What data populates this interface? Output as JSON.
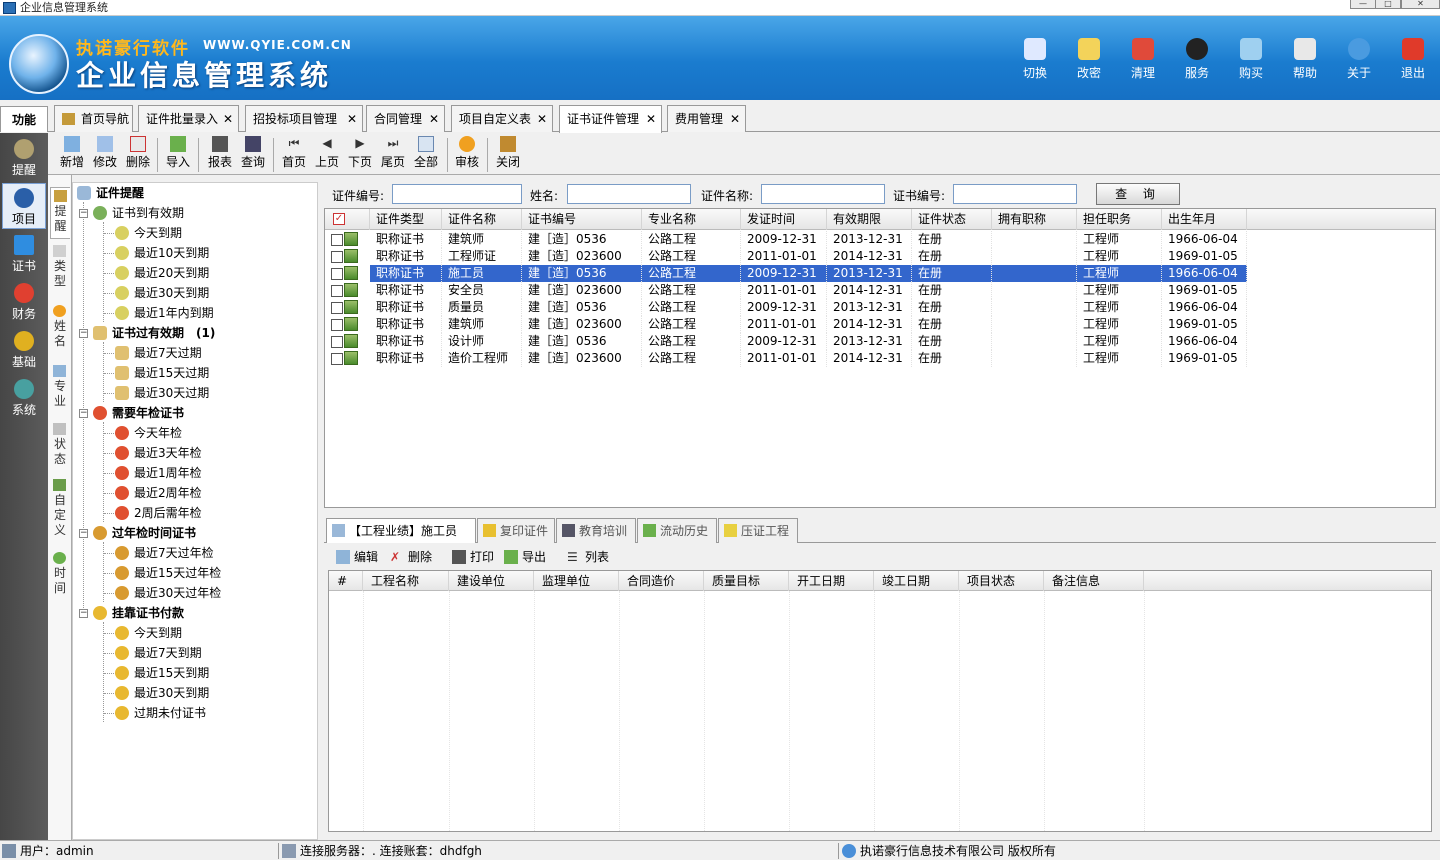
{
  "window": {
    "title": "企业信息管理系统"
  },
  "banner": {
    "brand": "执诺豪行软件",
    "url": "WWW.QYIE.COM.CN",
    "system_name": "企业信息管理系统"
  },
  "top_buttons": [
    "切换",
    "改密",
    "清理",
    "服务",
    "购买",
    "帮助",
    "关于",
    "退出"
  ],
  "func_label": "功能",
  "tabs": [
    "首页导航",
    "证件批量录入",
    "招投标项目管理",
    "合同管理",
    "项目自定义表",
    "证书证件管理",
    "费用管理"
  ],
  "toolbar": [
    "新增",
    "修改",
    "删除",
    "导入",
    "报表",
    "查询",
    "首页",
    "上页",
    "下页",
    "尾页",
    "全部",
    "审核",
    "关闭"
  ],
  "left_nav": [
    "提醒",
    "项目",
    "证书",
    "财务",
    "基础",
    "系统"
  ],
  "vtabs": [
    "提醒",
    "类型",
    "姓名",
    "专业",
    "状态",
    "自定义",
    "时间"
  ],
  "tree": {
    "root": "证件提醒",
    "nodes": [
      {
        "label": "证书到有效期",
        "children": [
          "今天到期",
          "最近10天到期",
          "最近20天到期",
          "最近30天到期",
          "最近1年内到期"
        ]
      },
      {
        "label": "证书过有效期　(1)",
        "bold": true,
        "children": [
          "最近7天过期",
          "最近15天过期",
          "最近30天过期"
        ]
      },
      {
        "label": "需要年检证书",
        "bold": true,
        "children": [
          "今天年检",
          "最近3天年检",
          "最近1周年检",
          "最近2周年检",
          "2周后需年检"
        ]
      },
      {
        "label": "过年检时间证书",
        "bold": true,
        "children": [
          "最近7天过年检",
          "最近15天过年检",
          "最近30天过年检"
        ]
      },
      {
        "label": "挂靠证书付款",
        "bold": true,
        "children": [
          "今天到期",
          "最近7天到期",
          "最近15天到期",
          "最近30天到期",
          "过期未付证书"
        ]
      }
    ]
  },
  "search": {
    "labels": [
      "证件编号:",
      "姓名:",
      "证件名称:",
      "证书编号:"
    ],
    "button": "查 询"
  },
  "grid": {
    "columns": [
      "证件类型",
      "证件名称",
      "证书编号",
      "专业名称",
      "发证时间",
      "有效期限",
      "证件状态",
      "拥有职称",
      "担任职务",
      "出生年月"
    ],
    "rows": [
      [
        "职称证书",
        "建筑师",
        "建［造］0536",
        "公路工程",
        "2009-12-31",
        "2013-12-31",
        "在册",
        "",
        "工程师",
        "1966-06-04"
      ],
      [
        "职称证书",
        "工程师证",
        "建［造］023600",
        "公路工程",
        "2011-01-01",
        "2014-12-31",
        "在册",
        "",
        "工程师",
        "1969-01-05"
      ],
      [
        "职称证书",
        "施工员",
        "建［造］0536",
        "公路工程",
        "2009-12-31",
        "2013-12-31",
        "在册",
        "",
        "工程师",
        "1966-06-04"
      ],
      [
        "职称证书",
        "安全员",
        "建［造］023600",
        "公路工程",
        "2011-01-01",
        "2014-12-31",
        "在册",
        "",
        "工程师",
        "1969-01-05"
      ],
      [
        "职称证书",
        "质量员",
        "建［造］0536",
        "公路工程",
        "2009-12-31",
        "2013-12-31",
        "在册",
        "",
        "工程师",
        "1966-06-04"
      ],
      [
        "职称证书",
        "建筑师",
        "建［造］023600",
        "公路工程",
        "2011-01-01",
        "2014-12-31",
        "在册",
        "",
        "工程师",
        "1969-01-05"
      ],
      [
        "职称证书",
        "设计师",
        "建［造］0536",
        "公路工程",
        "2009-12-31",
        "2013-12-31",
        "在册",
        "",
        "工程师",
        "1966-06-04"
      ],
      [
        "职称证书",
        "造价工程师",
        "建［造］023600",
        "公路工程",
        "2011-01-01",
        "2014-12-31",
        "在册",
        "",
        "工程师",
        "1969-01-05"
      ]
    ],
    "selected_row": 2
  },
  "bottom_tabs": [
    "【工程业绩】施工员",
    "复印证件",
    "教育培训",
    "流动历史",
    "压证工程"
  ],
  "bottom_toolbar": [
    "编辑",
    "删除",
    "打印",
    "导出",
    "列表"
  ],
  "bottom_grid": {
    "columns": [
      "#",
      "工程名称",
      "建设单位",
      "监理单位",
      "合同造价",
      "质量目标",
      "开工日期",
      "竣工日期",
      "项目状态",
      "备注信息"
    ]
  },
  "status": {
    "user": "用户：admin",
    "server": "连接服务器：.  连接账套：dhdfgh",
    "copyright": "执诺豪行信息技术有限公司 版权所有"
  }
}
